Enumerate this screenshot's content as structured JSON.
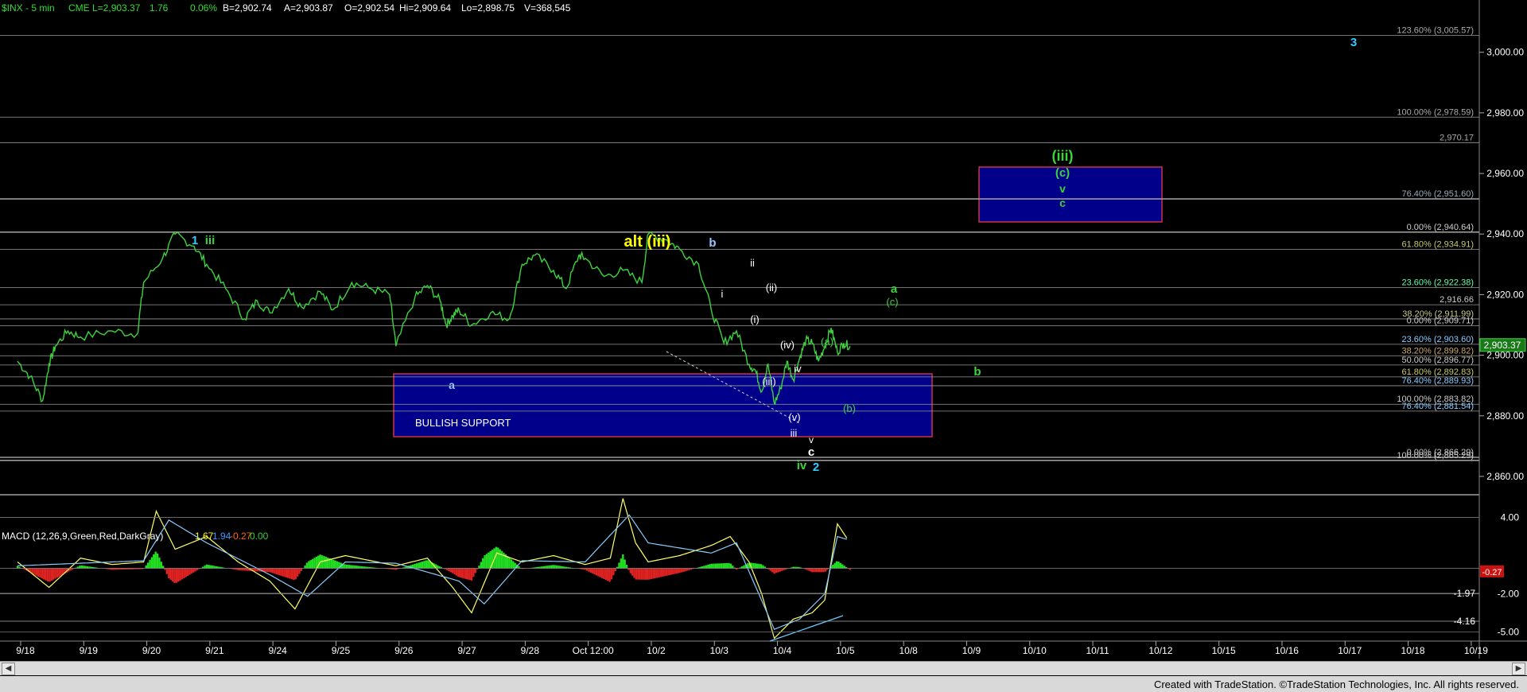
{
  "header": {
    "symbol": "$INX - 5 min",
    "last": "CME  L=2,903.37",
    "change": "1.76",
    "pct": "0.06%",
    "bid": "B=2,902.74",
    "ask": "A=2,903.87",
    "open": "O=2,902.54",
    "high": "Hi=2,909.64",
    "low": "Lo=2,898.75",
    "volume": "V=368,545"
  },
  "macd": {
    "label": "MACD (12,26,9,Green,Red,DarkGray)",
    "v1": "1.67",
    "v2": "1.94",
    "v3": "-0.27",
    "v4": "0.00"
  },
  "colors": {
    "price": "#3cd43c",
    "support_box": "#00008b",
    "wave_cyan": "#33ccff",
    "wave_yellow": "#ffff00",
    "wave_green": "#3cd43c"
  },
  "chart_data": [
    {
      "type": "line",
      "panel": "price",
      "ylim": [
        2855,
        3012
      ],
      "yticks": [
        "3,000.00",
        "2,980.00",
        "2,960.00",
        "2,940.00",
        "2,920.00",
        "2,900.00",
        "2,880.00",
        "2,860.00"
      ],
      "ytick_values": [
        3000,
        2980,
        2960,
        2940,
        2920,
        2900,
        2880,
        2860
      ],
      "current_price": "2,903.37",
      "x_labels": [
        "9/18",
        "9/19",
        "9/20",
        "9/21",
        "9/24",
        "9/25",
        "9/26",
        "9/27",
        "9/28",
        "Oct 12:00",
        "10/2",
        "10/3",
        "10/4",
        "10/5",
        "10/8",
        "10/9",
        "10/10",
        "10/11",
        "10/12",
        "10/15",
        "10/16",
        "10/17",
        "10/18",
        "10/19"
      ],
      "series": [
        {
          "x": [
            0,
            0.2,
            0.4,
            0.5,
            0.6,
            0.8,
            1.0,
            1.5,
            1.9,
            2.0,
            2.3,
            2.5,
            2.8,
            3.0,
            3.3,
            3.6,
            3.8,
            4.0,
            4.3,
            4.5,
            4.8,
            5.0,
            5.3,
            5.6,
            5.9,
            6.0,
            6.3,
            6.5,
            6.7,
            6.8,
            6.9,
            7.0,
            7.2,
            7.5,
            7.8,
            8.0,
            8.2,
            8.5,
            8.7,
            8.9,
            9.0,
            9.3,
            9.6,
            9.9,
            10.0,
            10.3,
            10.5,
            10.8,
            11.0,
            11.2,
            11.4,
            11.6,
            11.7,
            11.8,
            11.9,
            12.0,
            12.1,
            12.2,
            12.3,
            12.4,
            12.5,
            12.6,
            12.7,
            12.8,
            12.9,
            13.0,
            13.1,
            13.2
          ],
          "y": [
            2898,
            2893,
            2885,
            2897,
            2903,
            2908,
            2906,
            2908,
            2907,
            2924,
            2932,
            2940,
            2936,
            2930,
            2922,
            2912,
            2918,
            2914,
            2922,
            2916,
            2921,
            2915,
            2924,
            2922,
            2920,
            2903,
            2919,
            2923,
            2918,
            2910,
            2913,
            2915,
            2910,
            2914,
            2912,
            2930,
            2933,
            2928,
            2922,
            2933,
            2932,
            2926,
            2928,
            2924,
            2940,
            2938,
            2935,
            2930,
            2915,
            2904,
            2908,
            2897,
            2895,
            2888,
            2897,
            2884,
            2889,
            2898,
            2892,
            2899,
            2905,
            2904,
            2898,
            2903,
            2909,
            2901,
            2904,
            2903
          ]
        }
      ],
      "fib_levels": [
        {
          "label": "123.60% (3,005.57)",
          "value": 3005.57
        },
        {
          "label": "100.00% (2,978.59)",
          "value": 2978.59
        },
        {
          "label": "2,970.17",
          "value": 2970.17
        },
        {
          "label": "76.40% (2,951.60)",
          "value": 2951.6
        },
        {
          "label": "0.00% (2,940.64)",
          "value": 2940.64
        },
        {
          "label": "61.80% (2,934.91)",
          "value": 2934.91
        },
        {
          "label": "23.60% (2,922.38)",
          "value": 2922.38
        },
        {
          "label": "2,916.66",
          "value": 2916.66
        },
        {
          "label": "38.20% (2,911.99)",
          "value": 2911.99
        },
        {
          "label": "0.00% (2,909.71)",
          "value": 2909.71
        },
        {
          "label": "23.60% (2,903.60)",
          "value": 2903.6
        },
        {
          "label": "38.20% (2,899.82)",
          "value": 2899.82
        },
        {
          "label": "50.00% (2,896.77)",
          "value": 2896.77
        },
        {
          "label": "61.80% (2,892.83)",
          "value": 2892.83
        },
        {
          "label": "76.40% (2,889.93)",
          "value": 2889.93
        },
        {
          "label": "100.00% (2,883.82)",
          "value": 2883.82
        },
        {
          "label": "76.40% (2,881.54)",
          "value": 2881.54
        },
        {
          "label": "0.00% (2,866.29)",
          "value": 2866.29
        },
        {
          "label": "100.00% (2,865.29)",
          "value": 2865.29
        }
      ],
      "annotations": [
        {
          "text": "3",
          "color": "#33ccff",
          "bold": true
        },
        {
          "text": "1",
          "color": "#33ccff",
          "bold": true
        },
        {
          "text": "iii",
          "color": "#3cd43c",
          "bold": true
        },
        {
          "text": "alt (iii)",
          "color": "#ffff00",
          "bold": true
        },
        {
          "text": "b",
          "color": "#9ec8ff",
          "bold": true
        },
        {
          "text": "ii",
          "color": "#ffffff",
          "bold": false
        },
        {
          "text": "i",
          "color": "#ffffff",
          "bold": false
        },
        {
          "text": "(ii)",
          "color": "#ffffff",
          "bold": false
        },
        {
          "text": "(i)",
          "color": "#ffffff",
          "bold": false
        },
        {
          "text": "(iv)",
          "color": "#ffffff",
          "bold": false
        },
        {
          "text": "(iii)",
          "color": "#ffffff",
          "bold": false
        },
        {
          "text": "iv",
          "color": "#ffffff",
          "bold": false
        },
        {
          "text": "(v)",
          "color": "#ffffff",
          "bold": false
        },
        {
          "text": "iii",
          "color": "#ffffff",
          "bold": false
        },
        {
          "text": "v",
          "color": "#ffffff",
          "bold": false
        },
        {
          "text": "c",
          "color": "#ffffff",
          "bold": true
        },
        {
          "text": "iv",
          "color": "#3cd43c",
          "bold": true
        },
        {
          "text": "2",
          "color": "#33ccff",
          "bold": true
        },
        {
          "text": "(a)",
          "color": "#3cd43c",
          "bold": false
        },
        {
          "text": "(b)",
          "color": "#3cd43c",
          "bold": false
        },
        {
          "text": "a",
          "color": "#3cd43c",
          "bold": true
        },
        {
          "text": "(c)",
          "color": "#3cd43c",
          "bold": false
        },
        {
          "text": "b",
          "color": "#3cd43c",
          "bold": true
        },
        {
          "text": "(iii)",
          "color": "#3cd43c",
          "bold": true
        },
        {
          "text": "(c)",
          "color": "#3cd43c",
          "bold": true
        },
        {
          "text": "v",
          "color": "#3cd43c",
          "bold": true
        },
        {
          "text": "c",
          "color": "#3cd43c",
          "bold": true
        },
        {
          "text": "a",
          "color": "#9ec8ff",
          "bold": true
        },
        {
          "text": "BULLISH SUPPORT",
          "color": "#ffffff",
          "bold": false
        }
      ]
    },
    {
      "type": "area",
      "panel": "macd",
      "ylim": [
        -5.6,
        5.6
      ],
      "yticks": [
        "4.00",
        "-2.00",
        "-5.00"
      ],
      "ytick_values": [
        4,
        -2,
        -5
      ],
      "level_labels": [
        "-1.97",
        "-4.16"
      ],
      "level_values": [
        -1.97,
        -4.16
      ],
      "current_value": "-0.27",
      "series": [
        {
          "name": "MACD",
          "x": [
            0,
            0.5,
            1.0,
            1.5,
            2.0,
            2.2,
            2.5,
            3.0,
            3.5,
            4.0,
            4.4,
            4.8,
            5.2,
            6.0,
            6.5,
            6.9,
            7.2,
            7.6,
            8.0,
            8.5,
            9.0,
            9.4,
            9.6,
            9.8,
            10.0,
            10.5,
            11.0,
            11.3,
            11.6,
            11.8,
            12.0,
            12.3,
            12.6,
            12.8,
            13.0,
            13.2
          ],
          "y": [
            0.5,
            -1.5,
            0.8,
            0.3,
            0.5,
            4.5,
            1.5,
            2.5,
            0.5,
            -1.0,
            -3.2,
            0.5,
            1.0,
            0.2,
            0.8,
            -1.5,
            -3.5,
            1.2,
            0.5,
            1.0,
            0.3,
            0.8,
            5.5,
            2.0,
            0.5,
            1.0,
            1.8,
            2.5,
            0.5,
            -2.0,
            -5.5,
            -4.0,
            -3.5,
            -2.5,
            3.5,
            2.0
          ]
        },
        {
          "name": "Signal",
          "x": [
            0,
            1.0,
            2.0,
            2.4,
            3.0,
            4.0,
            4.6,
            5.2,
            6.0,
            7.0,
            7.4,
            8.0,
            9.0,
            9.7,
            10.0,
            11.0,
            11.4,
            12.0,
            12.4,
            12.8,
            13.0,
            13.2
          ],
          "y": [
            0.2,
            0.4,
            0.6,
            3.8,
            2.0,
            -0.5,
            -2.2,
            0.5,
            0.4,
            -1.0,
            -2.8,
            0.6,
            0.5,
            4.2,
            2.0,
            1.2,
            2.0,
            -4.8,
            -4.0,
            -2.0,
            2.5,
            2.2
          ]
        }
      ]
    }
  ],
  "footer": "Created with TradeStation. ©TradeStation Technologies, Inc. All rights reserved."
}
